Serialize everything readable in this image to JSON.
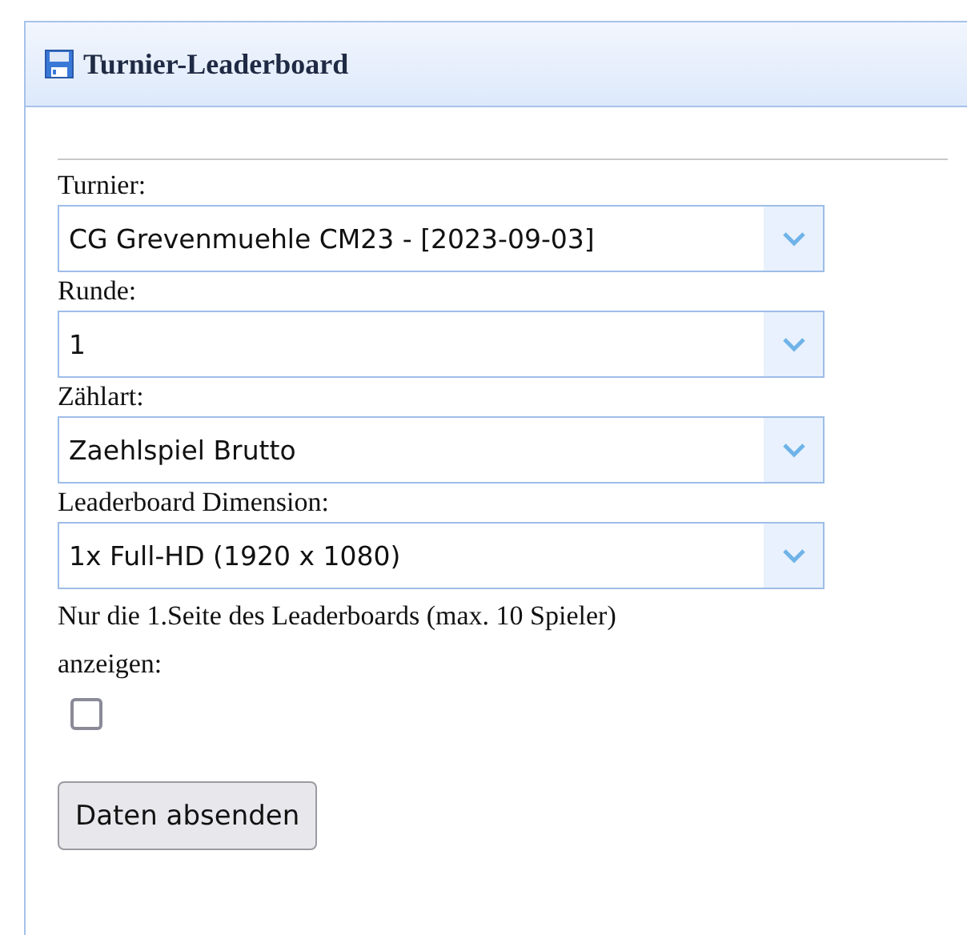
{
  "panel": {
    "title": "Turnier-Leaderboard"
  },
  "fields": [
    {
      "label": "Turnier:",
      "value": "CG Grevenmuehle CM23 - [2023-09-03]"
    },
    {
      "label": "Runde:",
      "value": "1"
    },
    {
      "label": "Zählart:",
      "value": "Zaehlspiel Brutto"
    },
    {
      "label": "Leaderboard Dimension:",
      "value": "1x Full-HD (1920 x 1080)"
    }
  ],
  "option": {
    "label": "Nur die 1.Seite des Leaderboards (max. 10 Spieler) anzeigen:",
    "checked": false
  },
  "submit_button": "Daten absenden"
}
